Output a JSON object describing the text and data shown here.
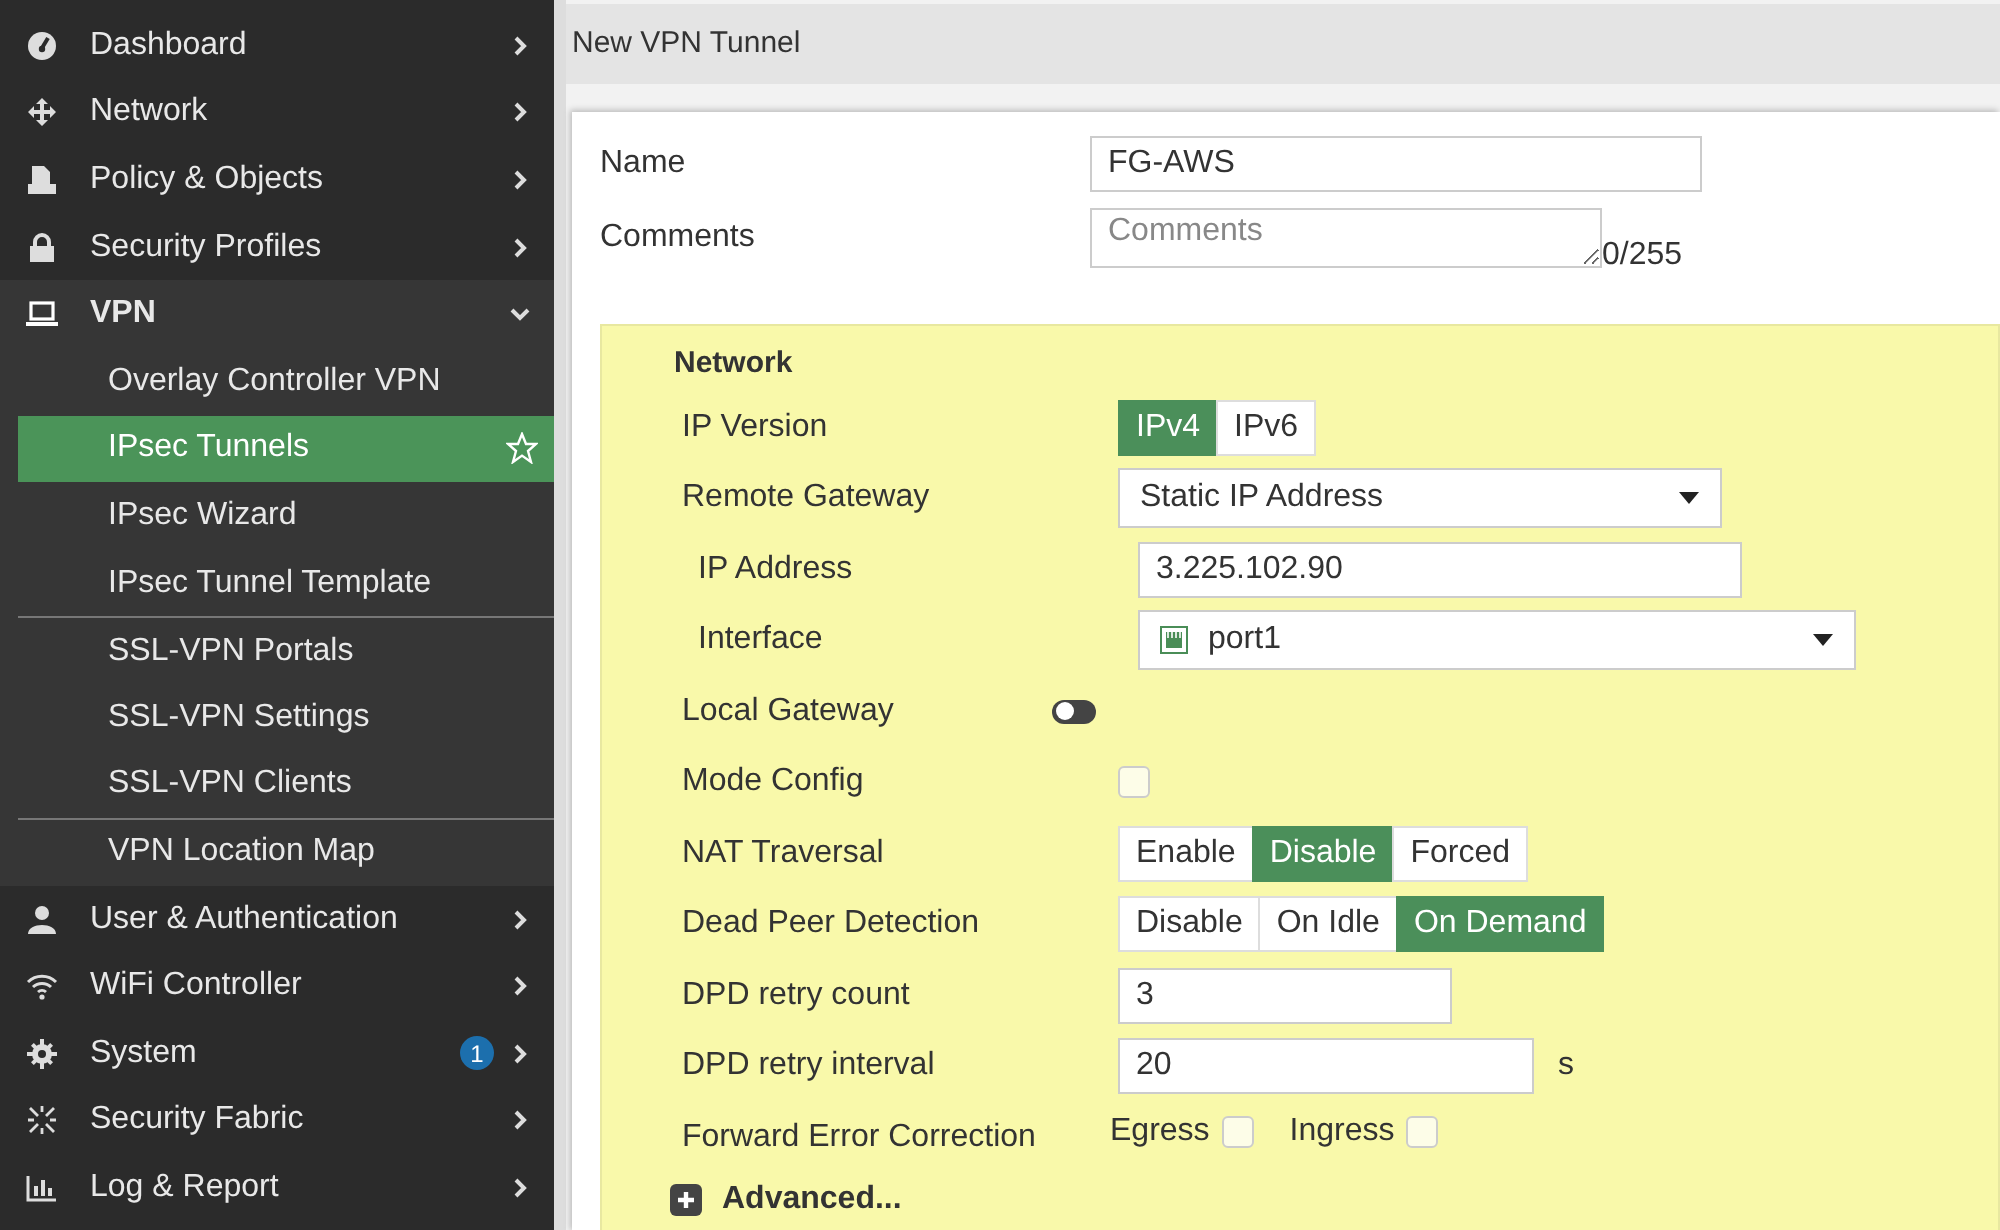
{
  "sidebar": {
    "items": [
      {
        "label": "Dashboard",
        "expanded": false
      },
      {
        "label": "Network",
        "expanded": false
      },
      {
        "label": "Policy & Objects",
        "expanded": false
      },
      {
        "label": "Security Profiles",
        "expanded": false
      },
      {
        "label": "VPN",
        "expanded": true,
        "children": [
          {
            "label": "Overlay Controller VPN",
            "selected": false,
            "divider_before": false
          },
          {
            "label": "IPsec Tunnels",
            "selected": true,
            "divider_before": false
          },
          {
            "label": "IPsec Wizard",
            "selected": false,
            "divider_before": false
          },
          {
            "label": "IPsec Tunnel Template",
            "selected": false,
            "divider_before": false
          },
          {
            "label": "SSL-VPN Portals",
            "selected": false,
            "divider_before": true
          },
          {
            "label": "SSL-VPN Settings",
            "selected": false,
            "divider_before": false
          },
          {
            "label": "SSL-VPN Clients",
            "selected": false,
            "divider_before": false
          },
          {
            "label": "VPN Location Map",
            "selected": false,
            "divider_before": true
          }
        ]
      },
      {
        "label": "User & Authentication",
        "expanded": false
      },
      {
        "label": "WiFi Controller",
        "expanded": false
      },
      {
        "label": "System",
        "expanded": false,
        "badge": "1"
      },
      {
        "label": "Security Fabric",
        "expanded": false
      },
      {
        "label": "Log & Report",
        "expanded": false
      }
    ]
  },
  "page_title": "New VPN Tunnel",
  "name": {
    "label": "Name",
    "value": "FG-AWS"
  },
  "comments": {
    "label": "Comments",
    "placeholder": "Comments",
    "counter": "0/255"
  },
  "network": {
    "heading": "Network",
    "rows": [
      {
        "kind": "segmented",
        "label": "IP Version",
        "options": [
          {
            "label": "IPv4",
            "selected": true
          },
          {
            "label": "IPv6",
            "selected": false
          }
        ]
      },
      {
        "kind": "select",
        "label": "Remote Gateway",
        "value": "Static IP Address",
        "children": [
          {
            "kind": "text",
            "label": "IP Address",
            "value": "3.225.102.90"
          },
          {
            "kind": "port-select",
            "label": "Interface",
            "value": "port1"
          }
        ]
      },
      {
        "kind": "toggle",
        "label": "Local Gateway",
        "on": false
      },
      {
        "kind": "checkbox",
        "label": "Mode Config",
        "checked": false
      },
      {
        "kind": "segmented",
        "label": "NAT Traversal",
        "options": [
          {
            "label": "Enable",
            "selected": false
          },
          {
            "label": "Disable",
            "selected": true
          },
          {
            "label": "Forced",
            "selected": false
          }
        ]
      },
      {
        "kind": "segmented",
        "label": "Dead Peer Detection",
        "options": [
          {
            "label": "Disable",
            "selected": false
          },
          {
            "label": "On Idle",
            "selected": false
          },
          {
            "label": "On Demand",
            "selected": true
          }
        ]
      },
      {
        "kind": "number",
        "label": "DPD retry count",
        "value": "3"
      },
      {
        "kind": "number",
        "label": "DPD retry interval",
        "value": "20",
        "unit": "s"
      },
      {
        "kind": "checks",
        "label": "Forward Error Correction",
        "options": [
          {
            "label": "Egress",
            "checked": false
          },
          {
            "label": "Ingress",
            "checked": false
          }
        ]
      }
    ],
    "advanced": "Advanced..."
  }
}
